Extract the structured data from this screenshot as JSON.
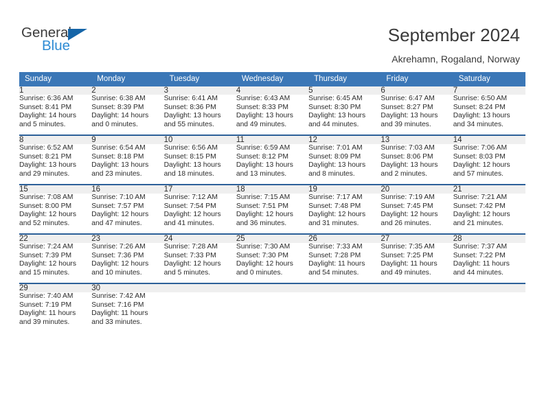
{
  "brand": {
    "name_top": "General",
    "name_bottom": "Blue",
    "accent_color": "#1565a8",
    "accent_color_light": "#2e8bd4"
  },
  "header": {
    "title": "September 2024",
    "subtitle": "Akrehamn, Rogaland, Norway"
  },
  "theme": {
    "header_bg": "#3b77b7",
    "header_text": "#ffffff",
    "week_separator": "#2c6099",
    "daynum_bg": "#efefef",
    "body_text": "#2b2b2b"
  },
  "calendar": {
    "weekday_headers": [
      "Sunday",
      "Monday",
      "Tuesday",
      "Wednesday",
      "Thursday",
      "Friday",
      "Saturday"
    ],
    "labels": {
      "sunrise": "Sunrise:",
      "sunset": "Sunset:",
      "daylight": "Daylight:"
    },
    "weeks": [
      {
        "days": [
          {
            "num": "1",
            "sunrise": "Sunrise: 6:36 AM",
            "sunset": "Sunset: 8:41 PM",
            "daylight_l1": "Daylight: 14 hours",
            "daylight_l2": "and 5 minutes."
          },
          {
            "num": "2",
            "sunrise": "Sunrise: 6:38 AM",
            "sunset": "Sunset: 8:39 PM",
            "daylight_l1": "Daylight: 14 hours",
            "daylight_l2": "and 0 minutes."
          },
          {
            "num": "3",
            "sunrise": "Sunrise: 6:41 AM",
            "sunset": "Sunset: 8:36 PM",
            "daylight_l1": "Daylight: 13 hours",
            "daylight_l2": "and 55 minutes."
          },
          {
            "num": "4",
            "sunrise": "Sunrise: 6:43 AM",
            "sunset": "Sunset: 8:33 PM",
            "daylight_l1": "Daylight: 13 hours",
            "daylight_l2": "and 49 minutes."
          },
          {
            "num": "5",
            "sunrise": "Sunrise: 6:45 AM",
            "sunset": "Sunset: 8:30 PM",
            "daylight_l1": "Daylight: 13 hours",
            "daylight_l2": "and 44 minutes."
          },
          {
            "num": "6",
            "sunrise": "Sunrise: 6:47 AM",
            "sunset": "Sunset: 8:27 PM",
            "daylight_l1": "Daylight: 13 hours",
            "daylight_l2": "and 39 minutes."
          },
          {
            "num": "7",
            "sunrise": "Sunrise: 6:50 AM",
            "sunset": "Sunset: 8:24 PM",
            "daylight_l1": "Daylight: 13 hours",
            "daylight_l2": "and 34 minutes."
          }
        ]
      },
      {
        "days": [
          {
            "num": "8",
            "sunrise": "Sunrise: 6:52 AM",
            "sunset": "Sunset: 8:21 PM",
            "daylight_l1": "Daylight: 13 hours",
            "daylight_l2": "and 29 minutes."
          },
          {
            "num": "9",
            "sunrise": "Sunrise: 6:54 AM",
            "sunset": "Sunset: 8:18 PM",
            "daylight_l1": "Daylight: 13 hours",
            "daylight_l2": "and 23 minutes."
          },
          {
            "num": "10",
            "sunrise": "Sunrise: 6:56 AM",
            "sunset": "Sunset: 8:15 PM",
            "daylight_l1": "Daylight: 13 hours",
            "daylight_l2": "and 18 minutes."
          },
          {
            "num": "11",
            "sunrise": "Sunrise: 6:59 AM",
            "sunset": "Sunset: 8:12 PM",
            "daylight_l1": "Daylight: 13 hours",
            "daylight_l2": "and 13 minutes."
          },
          {
            "num": "12",
            "sunrise": "Sunrise: 7:01 AM",
            "sunset": "Sunset: 8:09 PM",
            "daylight_l1": "Daylight: 13 hours",
            "daylight_l2": "and 8 minutes."
          },
          {
            "num": "13",
            "sunrise": "Sunrise: 7:03 AM",
            "sunset": "Sunset: 8:06 PM",
            "daylight_l1": "Daylight: 13 hours",
            "daylight_l2": "and 2 minutes."
          },
          {
            "num": "14",
            "sunrise": "Sunrise: 7:06 AM",
            "sunset": "Sunset: 8:03 PM",
            "daylight_l1": "Daylight: 12 hours",
            "daylight_l2": "and 57 minutes."
          }
        ]
      },
      {
        "days": [
          {
            "num": "15",
            "sunrise": "Sunrise: 7:08 AM",
            "sunset": "Sunset: 8:00 PM",
            "daylight_l1": "Daylight: 12 hours",
            "daylight_l2": "and 52 minutes."
          },
          {
            "num": "16",
            "sunrise": "Sunrise: 7:10 AM",
            "sunset": "Sunset: 7:57 PM",
            "daylight_l1": "Daylight: 12 hours",
            "daylight_l2": "and 47 minutes."
          },
          {
            "num": "17",
            "sunrise": "Sunrise: 7:12 AM",
            "sunset": "Sunset: 7:54 PM",
            "daylight_l1": "Daylight: 12 hours",
            "daylight_l2": "and 41 minutes."
          },
          {
            "num": "18",
            "sunrise": "Sunrise: 7:15 AM",
            "sunset": "Sunset: 7:51 PM",
            "daylight_l1": "Daylight: 12 hours",
            "daylight_l2": "and 36 minutes."
          },
          {
            "num": "19",
            "sunrise": "Sunrise: 7:17 AM",
            "sunset": "Sunset: 7:48 PM",
            "daylight_l1": "Daylight: 12 hours",
            "daylight_l2": "and 31 minutes."
          },
          {
            "num": "20",
            "sunrise": "Sunrise: 7:19 AM",
            "sunset": "Sunset: 7:45 PM",
            "daylight_l1": "Daylight: 12 hours",
            "daylight_l2": "and 26 minutes."
          },
          {
            "num": "21",
            "sunrise": "Sunrise: 7:21 AM",
            "sunset": "Sunset: 7:42 PM",
            "daylight_l1": "Daylight: 12 hours",
            "daylight_l2": "and 21 minutes."
          }
        ]
      },
      {
        "days": [
          {
            "num": "22",
            "sunrise": "Sunrise: 7:24 AM",
            "sunset": "Sunset: 7:39 PM",
            "daylight_l1": "Daylight: 12 hours",
            "daylight_l2": "and 15 minutes."
          },
          {
            "num": "23",
            "sunrise": "Sunrise: 7:26 AM",
            "sunset": "Sunset: 7:36 PM",
            "daylight_l1": "Daylight: 12 hours",
            "daylight_l2": "and 10 minutes."
          },
          {
            "num": "24",
            "sunrise": "Sunrise: 7:28 AM",
            "sunset": "Sunset: 7:33 PM",
            "daylight_l1": "Daylight: 12 hours",
            "daylight_l2": "and 5 minutes."
          },
          {
            "num": "25",
            "sunrise": "Sunrise: 7:30 AM",
            "sunset": "Sunset: 7:30 PM",
            "daylight_l1": "Daylight: 12 hours",
            "daylight_l2": "and 0 minutes."
          },
          {
            "num": "26",
            "sunrise": "Sunrise: 7:33 AM",
            "sunset": "Sunset: 7:28 PM",
            "daylight_l1": "Daylight: 11 hours",
            "daylight_l2": "and 54 minutes."
          },
          {
            "num": "27",
            "sunrise": "Sunrise: 7:35 AM",
            "sunset": "Sunset: 7:25 PM",
            "daylight_l1": "Daylight: 11 hours",
            "daylight_l2": "and 49 minutes."
          },
          {
            "num": "28",
            "sunrise": "Sunrise: 7:37 AM",
            "sunset": "Sunset: 7:22 PM",
            "daylight_l1": "Daylight: 11 hours",
            "daylight_l2": "and 44 minutes."
          }
        ]
      },
      {
        "days": [
          {
            "num": "29",
            "sunrise": "Sunrise: 7:40 AM",
            "sunset": "Sunset: 7:19 PM",
            "daylight_l1": "Daylight: 11 hours",
            "daylight_l2": "and 39 minutes."
          },
          {
            "num": "30",
            "sunrise": "Sunrise: 7:42 AM",
            "sunset": "Sunset: 7:16 PM",
            "daylight_l1": "Daylight: 11 hours",
            "daylight_l2": "and 33 minutes."
          },
          {
            "num": "",
            "sunrise": "",
            "sunset": "",
            "daylight_l1": "",
            "daylight_l2": ""
          },
          {
            "num": "",
            "sunrise": "",
            "sunset": "",
            "daylight_l1": "",
            "daylight_l2": ""
          },
          {
            "num": "",
            "sunrise": "",
            "sunset": "",
            "daylight_l1": "",
            "daylight_l2": ""
          },
          {
            "num": "",
            "sunrise": "",
            "sunset": "",
            "daylight_l1": "",
            "daylight_l2": ""
          },
          {
            "num": "",
            "sunrise": "",
            "sunset": "",
            "daylight_l1": "",
            "daylight_l2": ""
          }
        ]
      }
    ]
  }
}
